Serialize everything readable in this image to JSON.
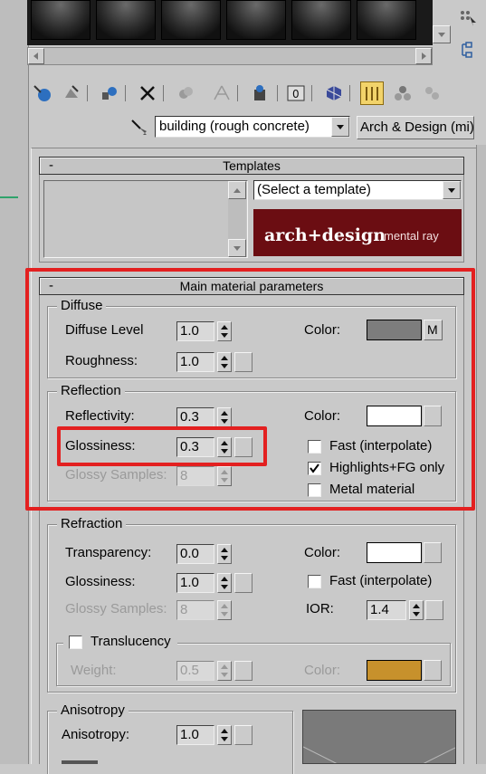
{
  "material_type": {
    "dropdown": "building (rough concrete)",
    "button": "Arch & Design (mi)"
  },
  "templates": {
    "rollout_title": "Templates",
    "select_placeholder": "(Select a template)",
    "banner_main": "arch+design",
    "banner_sub": "mental ray",
    "banner_color": "#6b0d12"
  },
  "main": {
    "rollout_title": "Main material parameters",
    "diffuse": {
      "group": "Diffuse",
      "level_label": "Diffuse Level",
      "level_value": "1.0",
      "roughness_label": "Roughness:",
      "roughness_value": "1.0",
      "color_label": "Color:",
      "color": "#7d7d7d",
      "map_label": "M"
    },
    "reflection": {
      "group": "Reflection",
      "reflectivity_label": "Reflectivity:",
      "reflectivity_value": "0.3",
      "glossiness_label": "Glossiness:",
      "glossiness_value": "0.3",
      "glossy_samples_label": "Glossy Samples:",
      "glossy_samples_value": "8",
      "color_label": "Color:",
      "color": "#ffffff",
      "fast_label": "Fast (interpolate)",
      "fast_checked": false,
      "highlights_label": "Highlights+FG only",
      "highlights_checked": true,
      "metal_label": "Metal material",
      "metal_checked": false
    },
    "refraction": {
      "group": "Refraction",
      "transparency_label": "Transparency:",
      "transparency_value": "0.0",
      "glossiness_label": "Glossiness:",
      "glossiness_value": "1.0",
      "glossy_samples_label": "Glossy Samples:",
      "glossy_samples_value": "8",
      "color_label": "Color:",
      "color": "#ffffff",
      "fast_label": "Fast (interpolate)",
      "fast_checked": false,
      "ior_label": "IOR:",
      "ior_value": "1.4",
      "translucency_label": "Translucency",
      "translucency_checked": false,
      "weight_label": "Weight:",
      "weight_value": "0.5",
      "trans_color_label": "Color:",
      "trans_color": "#c7912c"
    },
    "anisotropy": {
      "group": "Anisotropy",
      "anisotropy_label": "Anisotropy:",
      "anisotropy_value": "1.0"
    }
  },
  "highlight_color": "#e32020"
}
